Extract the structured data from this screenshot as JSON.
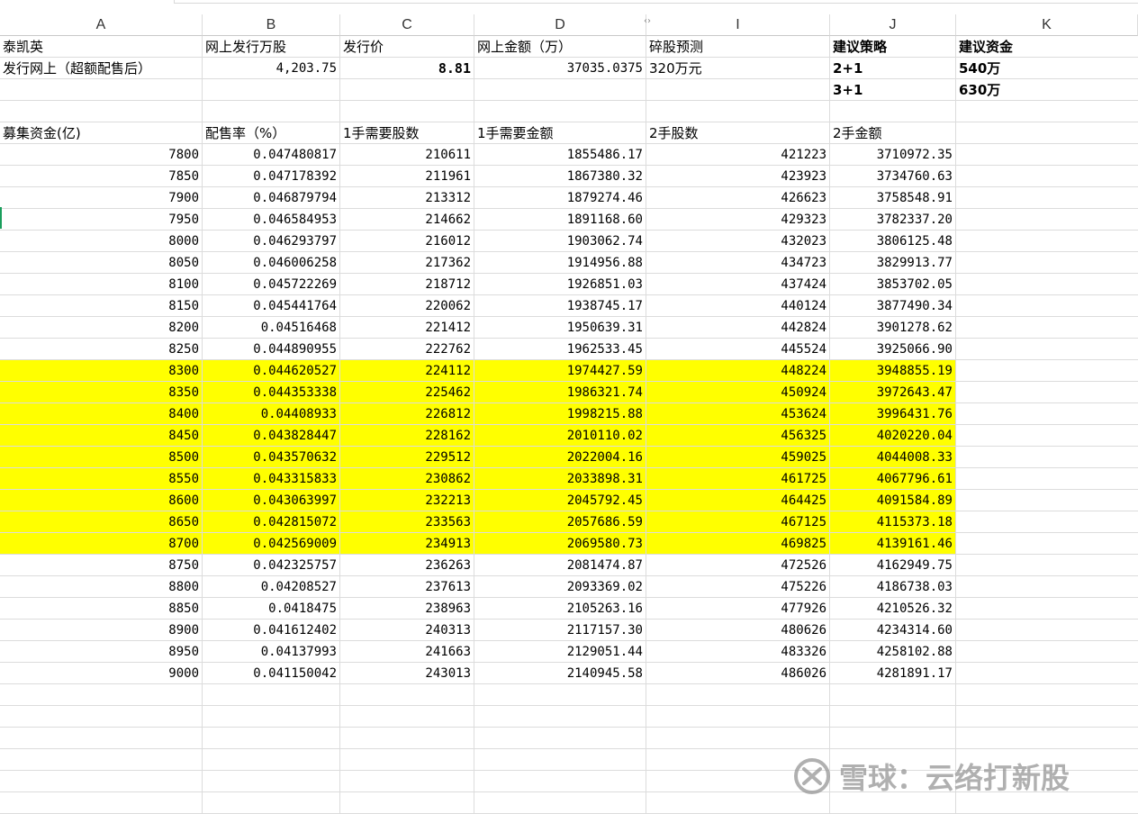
{
  "columns": [
    "A",
    "B",
    "C",
    "D",
    "I",
    "J",
    "K"
  ],
  "info_rows": [
    [
      "泰凯英",
      "网上发行万股",
      "发行价",
      "网上金额（万）",
      "碎股预测",
      "建议策略",
      "建议资金"
    ],
    [
      "发行网上（超额配售后）",
      "4,203.75",
      "8.81",
      "37035.0375",
      "320万元",
      "2+1",
      "540万"
    ],
    [
      "",
      "",
      "",
      "",
      "",
      "3+1",
      "630万"
    ],
    [
      "",
      "",
      "",
      "",
      "",
      "",
      ""
    ],
    [
      "募集资金(亿)",
      "配售率（%）",
      "1手需要股数",
      "1手需要金额",
      "2手股数",
      "2手金额",
      ""
    ]
  ],
  "data_rows": [
    [
      "7800",
      "0.047480817",
      "210611",
      "1855486.17",
      "421223",
      "3710972.35"
    ],
    [
      "7850",
      "0.047178392",
      "211961",
      "1867380.32",
      "423923",
      "3734760.63"
    ],
    [
      "7900",
      "0.046879794",
      "213312",
      "1879274.46",
      "426623",
      "3758548.91"
    ],
    [
      "7950",
      "0.046584953",
      "214662",
      "1891168.60",
      "429323",
      "3782337.20"
    ],
    [
      "8000",
      "0.046293797",
      "216012",
      "1903062.74",
      "432023",
      "3806125.48"
    ],
    [
      "8050",
      "0.046006258",
      "217362",
      "1914956.88",
      "434723",
      "3829913.77"
    ],
    [
      "8100",
      "0.045722269",
      "218712",
      "1926851.03",
      "437424",
      "3853702.05"
    ],
    [
      "8150",
      "0.045441764",
      "220062",
      "1938745.17",
      "440124",
      "3877490.34"
    ],
    [
      "8200",
      "0.04516468",
      "221412",
      "1950639.31",
      "442824",
      "3901278.62"
    ],
    [
      "8250",
      "0.044890955",
      "222762",
      "1962533.45",
      "445524",
      "3925066.90"
    ],
    [
      "8300",
      "0.044620527",
      "224112",
      "1974427.59",
      "448224",
      "3948855.19"
    ],
    [
      "8350",
      "0.044353338",
      "225462",
      "1986321.74",
      "450924",
      "3972643.47"
    ],
    [
      "8400",
      "0.04408933",
      "226812",
      "1998215.88",
      "453624",
      "3996431.76"
    ],
    [
      "8450",
      "0.043828447",
      "228162",
      "2010110.02",
      "456325",
      "4020220.04"
    ],
    [
      "8500",
      "0.043570632",
      "229512",
      "2022004.16",
      "459025",
      "4044008.33"
    ],
    [
      "8550",
      "0.043315833",
      "230862",
      "2033898.31",
      "461725",
      "4067796.61"
    ],
    [
      "8600",
      "0.043063997",
      "232213",
      "2045792.45",
      "464425",
      "4091584.89"
    ],
    [
      "8650",
      "0.042815072",
      "233563",
      "2057686.59",
      "467125",
      "4115373.18"
    ],
    [
      "8700",
      "0.042569009",
      "234913",
      "2069580.73",
      "469825",
      "4139161.46"
    ],
    [
      "8750",
      "0.042325757",
      "236263",
      "2081474.87",
      "472526",
      "4162949.75"
    ],
    [
      "8800",
      "0.04208527",
      "237613",
      "2093369.02",
      "475226",
      "4186738.03"
    ],
    [
      "8850",
      "0.0418475",
      "238963",
      "2105263.16",
      "477926",
      "4210526.32"
    ],
    [
      "8900",
      "0.041612402",
      "240313",
      "2117157.30",
      "480626",
      "4234314.60"
    ],
    [
      "8950",
      "0.04137993",
      "241663",
      "2129051.44",
      "483326",
      "4258102.88"
    ],
    [
      "9000",
      "0.041150042",
      "243013",
      "2140945.58",
      "486026",
      "4281891.17"
    ]
  ],
  "highlight_first": "8300",
  "highlight_last": "8700",
  "highlight_color": "#ffff00",
  "watermark": "雪球：云络打新股"
}
